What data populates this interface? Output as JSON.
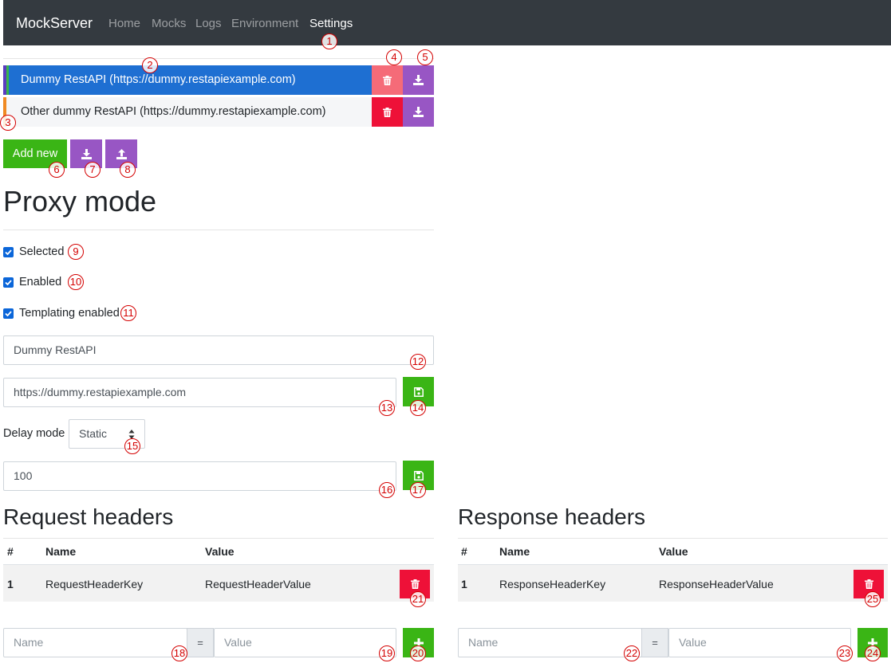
{
  "navbar": {
    "brand": "MockServer",
    "links": [
      {
        "label": "Home",
        "active": false
      },
      {
        "label": "Mocks",
        "active": false
      },
      {
        "label": "Logs",
        "active": false
      },
      {
        "label": "Environment",
        "active": false
      },
      {
        "label": "Settings",
        "active": true
      }
    ]
  },
  "environments": [
    {
      "label": "Dummy RestAPI (https://dummy.restapiexample.com)",
      "active": true
    },
    {
      "label": "Other dummy RestAPI (https://dummy.restapiexample.com)",
      "active": false
    }
  ],
  "actions": {
    "add_new_label": "Add new"
  },
  "proxy": {
    "title": "Proxy mode",
    "checkboxes": [
      {
        "label": "Selected",
        "checked": true
      },
      {
        "label": "Enabled",
        "checked": true
      },
      {
        "label": "Templating enabled",
        "checked": true
      }
    ],
    "name_value": "Dummy RestAPI",
    "url_value": "https://dummy.restapiexample.com",
    "delay_mode_label": "Delay mode",
    "delay_mode_value": "Static",
    "delay_value": "100"
  },
  "request_headers": {
    "title": "Request headers",
    "columns": [
      "#",
      "Name",
      "Value"
    ],
    "rows": [
      {
        "index": "1",
        "name": "RequestHeaderKey",
        "value": "RequestHeaderValue"
      }
    ],
    "new_name_placeholder": "Name",
    "equals": "=",
    "new_value_placeholder": "Value"
  },
  "response_headers": {
    "title": "Response headers",
    "columns": [
      "#",
      "Name",
      "Value"
    ],
    "rows": [
      {
        "index": "1",
        "name": "ResponseHeaderKey",
        "value": "ResponseHeaderValue"
      }
    ],
    "new_name_placeholder": "Name",
    "equals": "=",
    "new_value_placeholder": "Value"
  },
  "annotations": [
    "1",
    "2",
    "3",
    "4",
    "5",
    "6",
    "7",
    "8",
    "9",
    "10",
    "11",
    "12",
    "13",
    "14",
    "15",
    "16",
    "17",
    "18",
    "19",
    "20",
    "21",
    "22",
    "23",
    "24",
    "25"
  ],
  "colors": {
    "navbar": "#343a40",
    "active_env": "#1e6fd2",
    "danger": "#ee1138",
    "purple": "#9856c4",
    "success": "#3ab515",
    "checkbox": "#0b66d9",
    "annotation": "#d40000"
  },
  "icons": {
    "delete": "trash-icon",
    "export": "download-icon",
    "import": "upload-icon",
    "save": "floppy-disk-icon",
    "add": "plus-icon",
    "select": "sort-arrows-icon",
    "check": "checkmark-icon"
  }
}
